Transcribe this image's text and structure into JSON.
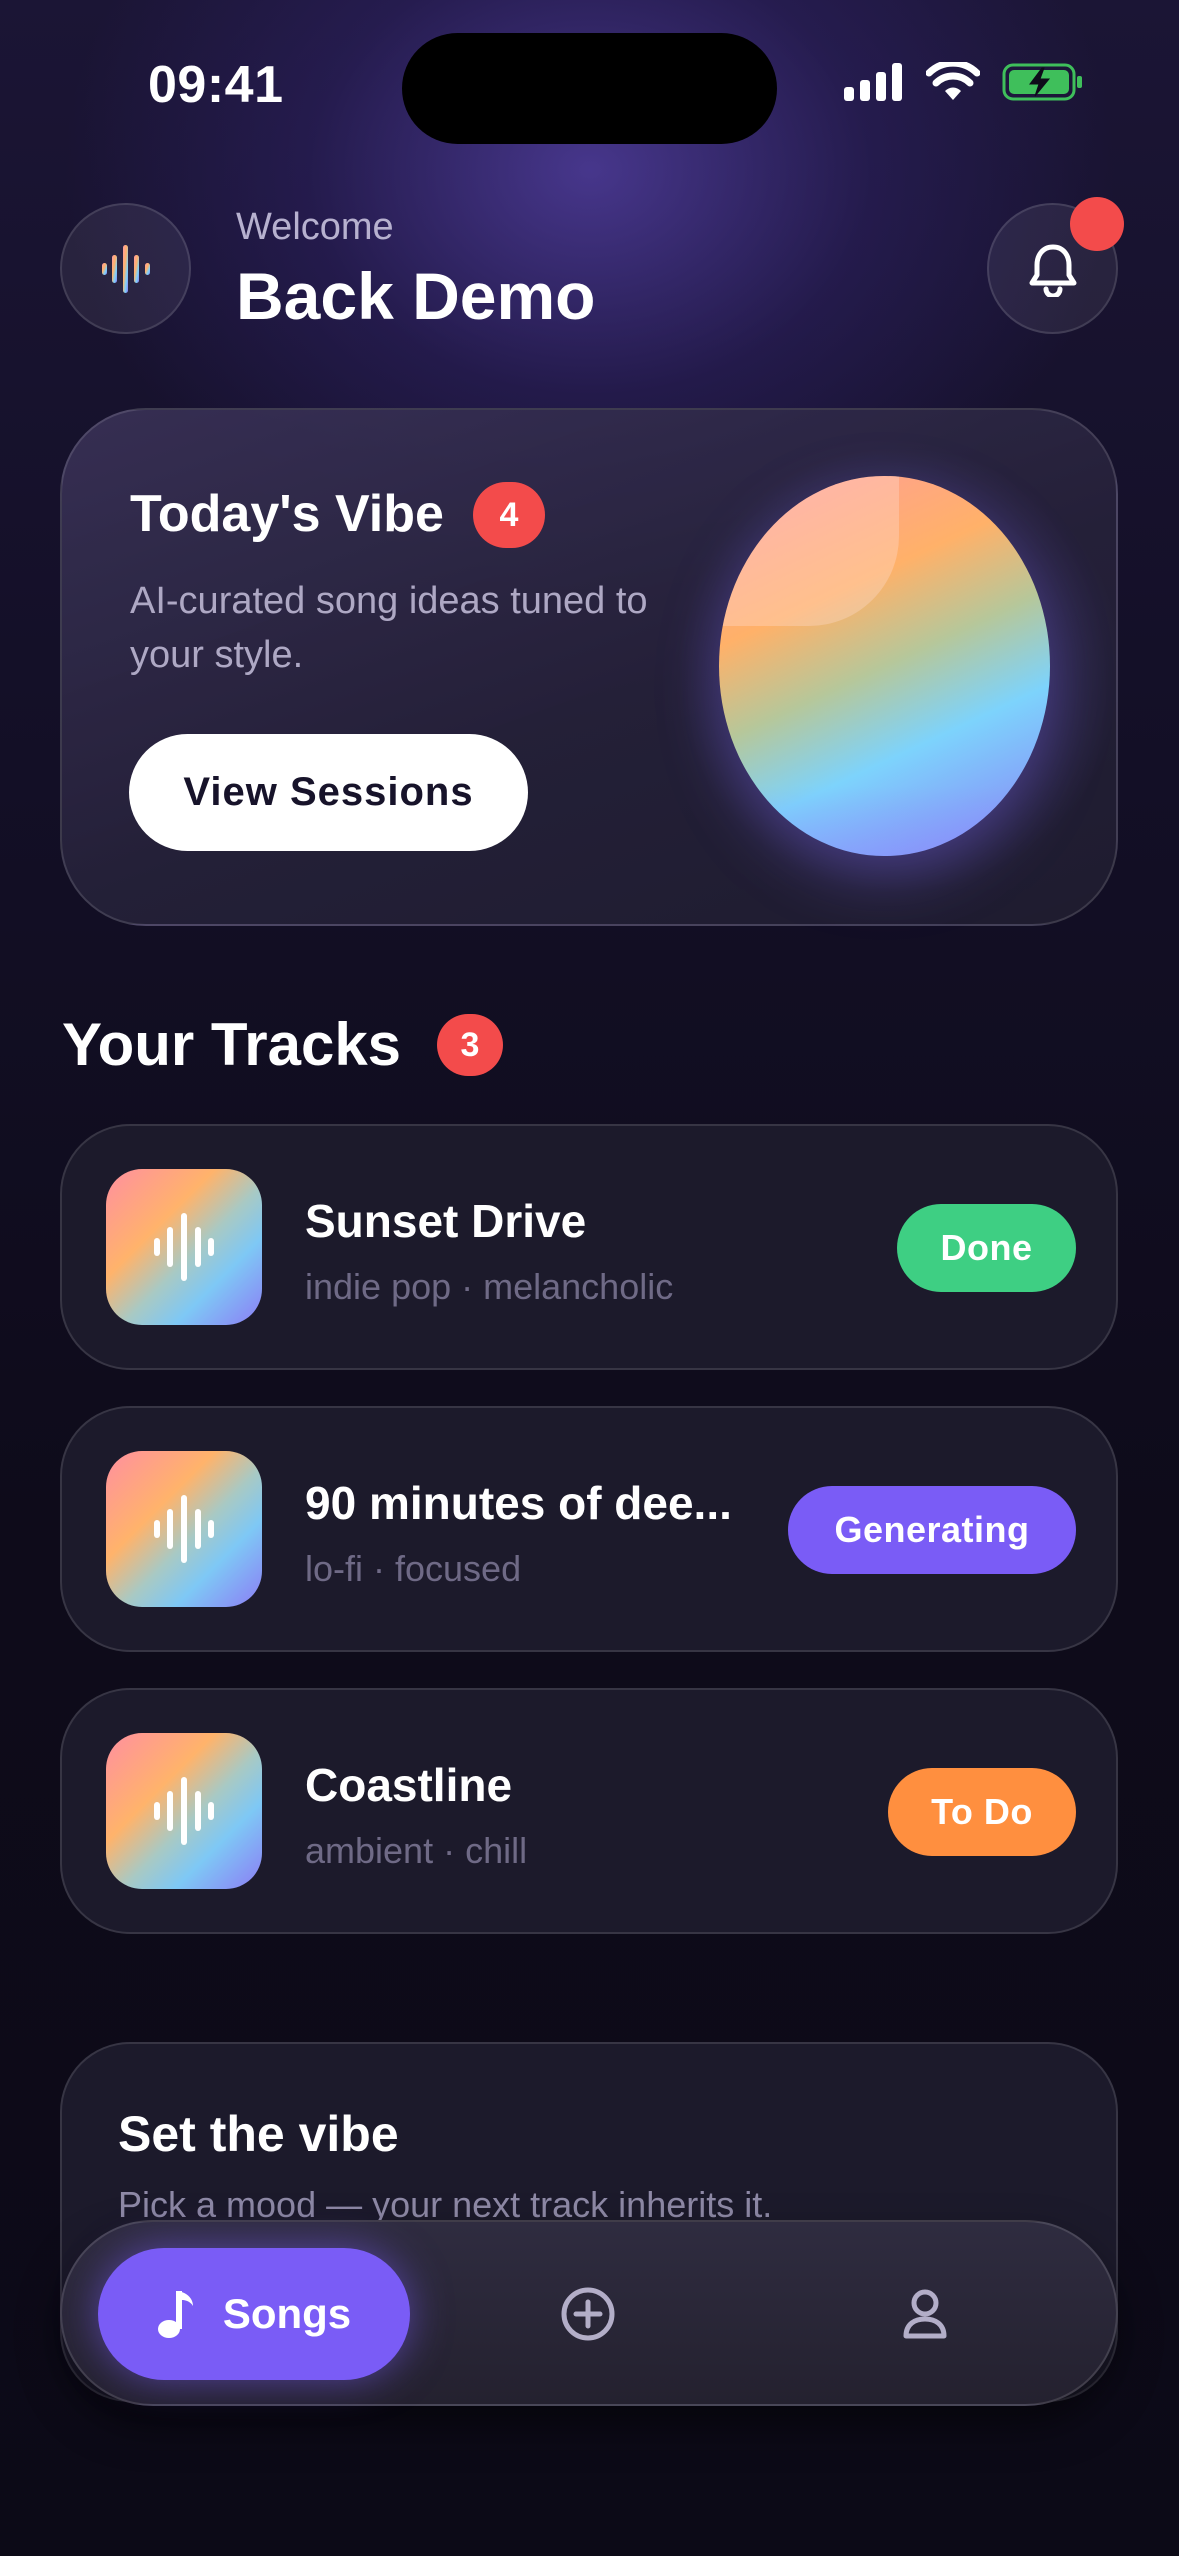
{
  "status_bar": {
    "time": "09:41"
  },
  "header": {
    "welcome": "Welcome",
    "username": "Back Demo"
  },
  "vibe_card": {
    "title": "Today's Vibe",
    "badge": "4",
    "description": "AI-curated song ideas tuned to your style.",
    "button_label": "View Sessions"
  },
  "tracks": {
    "title": "Your Tracks",
    "badge": "3",
    "items": [
      {
        "name": "Sunset Drive",
        "meta": "indie pop · melancholic",
        "status": "Done",
        "status_color": "#3ecf83"
      },
      {
        "name": "90 minutes of dee...",
        "meta": "lo-fi · focused",
        "status": "Generating",
        "status_color": "#7a5cf6"
      },
      {
        "name": "Coastline",
        "meta": "ambient · chill",
        "status": "To Do",
        "status_color": "#ff8f3f"
      }
    ]
  },
  "set_vibe": {
    "title": "Set the vibe",
    "subtitle": "Pick a mood — your next track inherits it."
  },
  "tab_bar": {
    "songs_label": "Songs",
    "active": "songs",
    "icons": [
      "music-note-icon",
      "plus-circle-icon",
      "profile-icon"
    ]
  },
  "colors": {
    "accent": "#7a5cf6",
    "badge_red": "#f34b4b",
    "done_green": "#3ecf83",
    "todo_orange": "#ff8f3f"
  }
}
